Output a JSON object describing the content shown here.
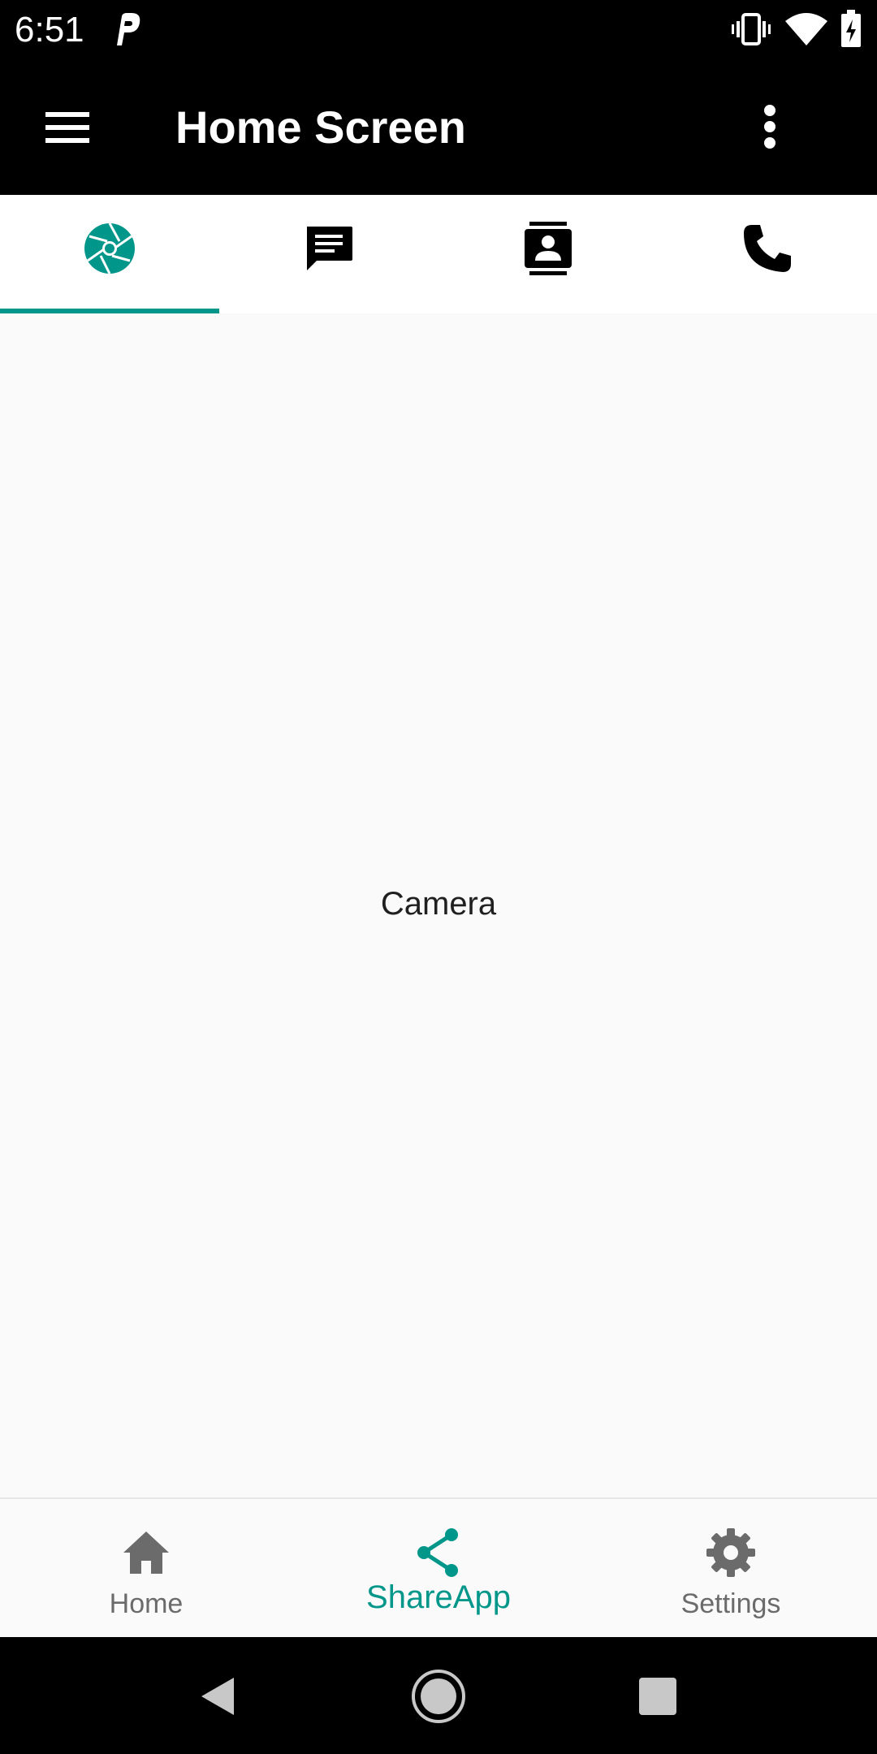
{
  "status_bar": {
    "time": "6:51",
    "icons": [
      "parking-app-icon",
      "vibrate-icon",
      "wifi-icon",
      "battery-charging-icon"
    ]
  },
  "app_bar": {
    "title": "Home Screen",
    "menu_icon": "hamburger-menu-icon",
    "overflow_icon": "more-vert-icon"
  },
  "tabs": [
    {
      "icon": "camera-shutter-icon",
      "selected": true
    },
    {
      "icon": "message-icon",
      "selected": false
    },
    {
      "icon": "contacts-icon",
      "selected": false
    },
    {
      "icon": "phone-icon",
      "selected": false
    }
  ],
  "content": {
    "label": "Camera"
  },
  "bottom_nav": {
    "items": [
      {
        "label": "Home",
        "icon": "home-icon",
        "active": false
      },
      {
        "label": "ShareApp",
        "icon": "share-icon",
        "active": true
      },
      {
        "label": "Settings",
        "icon": "gear-icon",
        "active": false
      }
    ]
  },
  "system_nav": {
    "buttons": [
      "back-icon",
      "home-circle-icon",
      "recents-icon"
    ]
  },
  "colors": {
    "accent": "#00978a",
    "app_bar": "#000000",
    "inactive_nav": "#6b6b6b",
    "background": "#fafafa"
  }
}
